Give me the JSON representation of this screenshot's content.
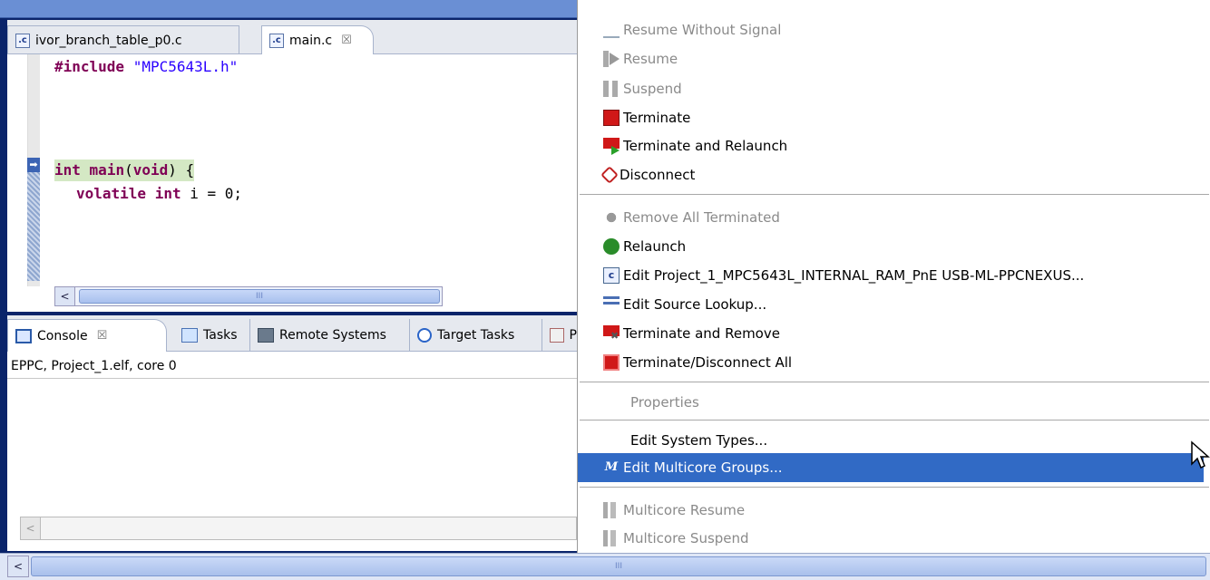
{
  "editor": {
    "tabs": [
      {
        "label": "ivor_branch_table_p0.c",
        "icon": "c-file-icon"
      },
      {
        "label": "main.c",
        "icon": "c-file-icon",
        "close": "☒"
      }
    ],
    "code": {
      "line1": {
        "keyword": "#include",
        "string": "\"MPC5643L.h\""
      },
      "line2": {
        "kw1": "int",
        "name": "main",
        "paren_open": "(",
        "kw2": "void",
        "rest": ") {"
      },
      "line3": {
        "kw1": "volatile",
        "kw2": "int",
        "rest": "i = 0;"
      }
    },
    "scroll_left": "<",
    "scroll_grip": "III"
  },
  "console": {
    "tabs": [
      {
        "label": "Console",
        "icon": "console-icon",
        "close": "☒"
      },
      {
        "label": "Tasks",
        "icon": "tasks-icon"
      },
      {
        "label": "Remote Systems",
        "icon": "remote-systems-icon"
      },
      {
        "label": "Target Tasks",
        "icon": "target-tasks-icon"
      },
      {
        "label": "P",
        "icon": "properties-icon"
      }
    ],
    "process_label": "EPPC, Project_1.elf, core 0",
    "scroll_left": "<"
  },
  "bottom_scroll": {
    "left": "<",
    "grip": "III"
  },
  "menu": {
    "items": [
      {
        "label": "Resume Without Signal",
        "disabled": true
      },
      {
        "label": "Resume",
        "disabled": true
      },
      {
        "label": "Suspend",
        "disabled": true
      },
      {
        "label": "Terminate",
        "disabled": false
      },
      {
        "label": "Terminate and Relaunch",
        "disabled": false
      },
      {
        "label": "Disconnect",
        "disabled": false
      },
      {
        "label": "Remove All Terminated",
        "disabled": true
      },
      {
        "label": "Relaunch",
        "disabled": false
      },
      {
        "label": "Edit Project_1_MPC5643L_INTERNAL_RAM_PnE USB-ML-PPCNEXUS...",
        "disabled": false
      },
      {
        "label": "Edit Source Lookup...",
        "disabled": false
      },
      {
        "label": "Terminate and Remove",
        "disabled": false
      },
      {
        "label": "Terminate/Disconnect All",
        "disabled": false
      },
      {
        "label": "Properties",
        "disabled": true
      },
      {
        "label": "Edit System Types...",
        "disabled": false
      },
      {
        "label": "Edit Multicore Groups...",
        "disabled": false,
        "selected": true
      },
      {
        "label": "Multicore Resume",
        "disabled": true
      },
      {
        "label": "Multicore Suspend",
        "disabled": true
      }
    ],
    "multicore_icon_glyph": "M"
  },
  "colors": {
    "selection": "#316ac5",
    "keyword": "#7f0055",
    "string": "#2a00ff"
  }
}
